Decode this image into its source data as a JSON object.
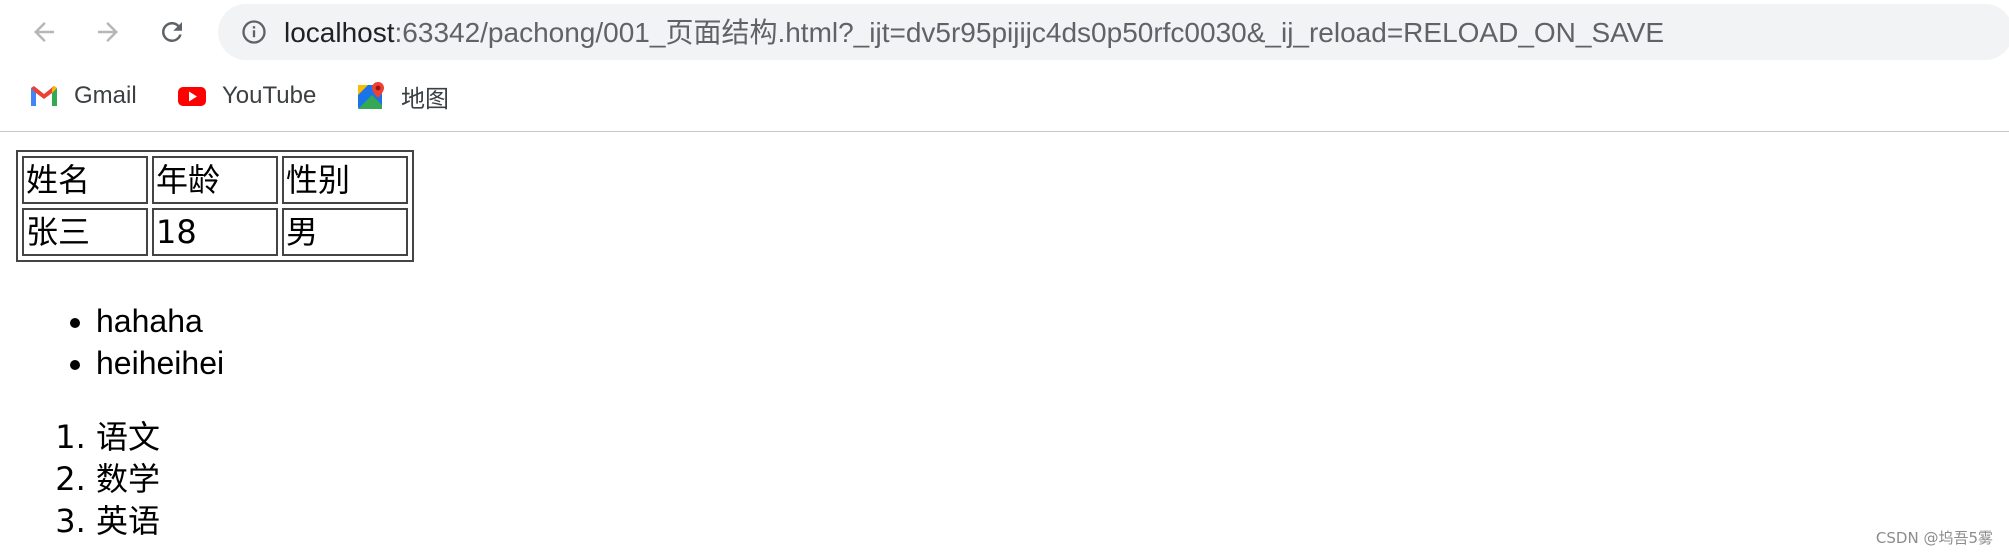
{
  "browser": {
    "url_host": "localhost",
    "url_rest": ":63342/pachong/001_页面结构.html?_ijt=dv5r95pijijc4ds0p50rfc0030&_ij_reload=RELOAD_ON_SAVE",
    "bookmarks": [
      {
        "label": "Gmail",
        "icon": "gmail-icon"
      },
      {
        "label": "YouTube",
        "icon": "youtube-icon"
      },
      {
        "label": "地图",
        "icon": "maps-icon"
      }
    ]
  },
  "table": {
    "header": [
      "姓名",
      "年龄",
      "性别"
    ],
    "rows": [
      [
        "张三",
        "18",
        "男"
      ]
    ]
  },
  "unordered_list": [
    "hahaha",
    "heiheihei"
  ],
  "ordered_list": [
    "语文",
    "数学",
    "英语"
  ],
  "watermark": "CSDN @坞吾5雾",
  "colors": {
    "omnibox_bg": "#f1f3f4",
    "youtube_red": "#ff0000",
    "gmail_red": "#ea4335"
  }
}
